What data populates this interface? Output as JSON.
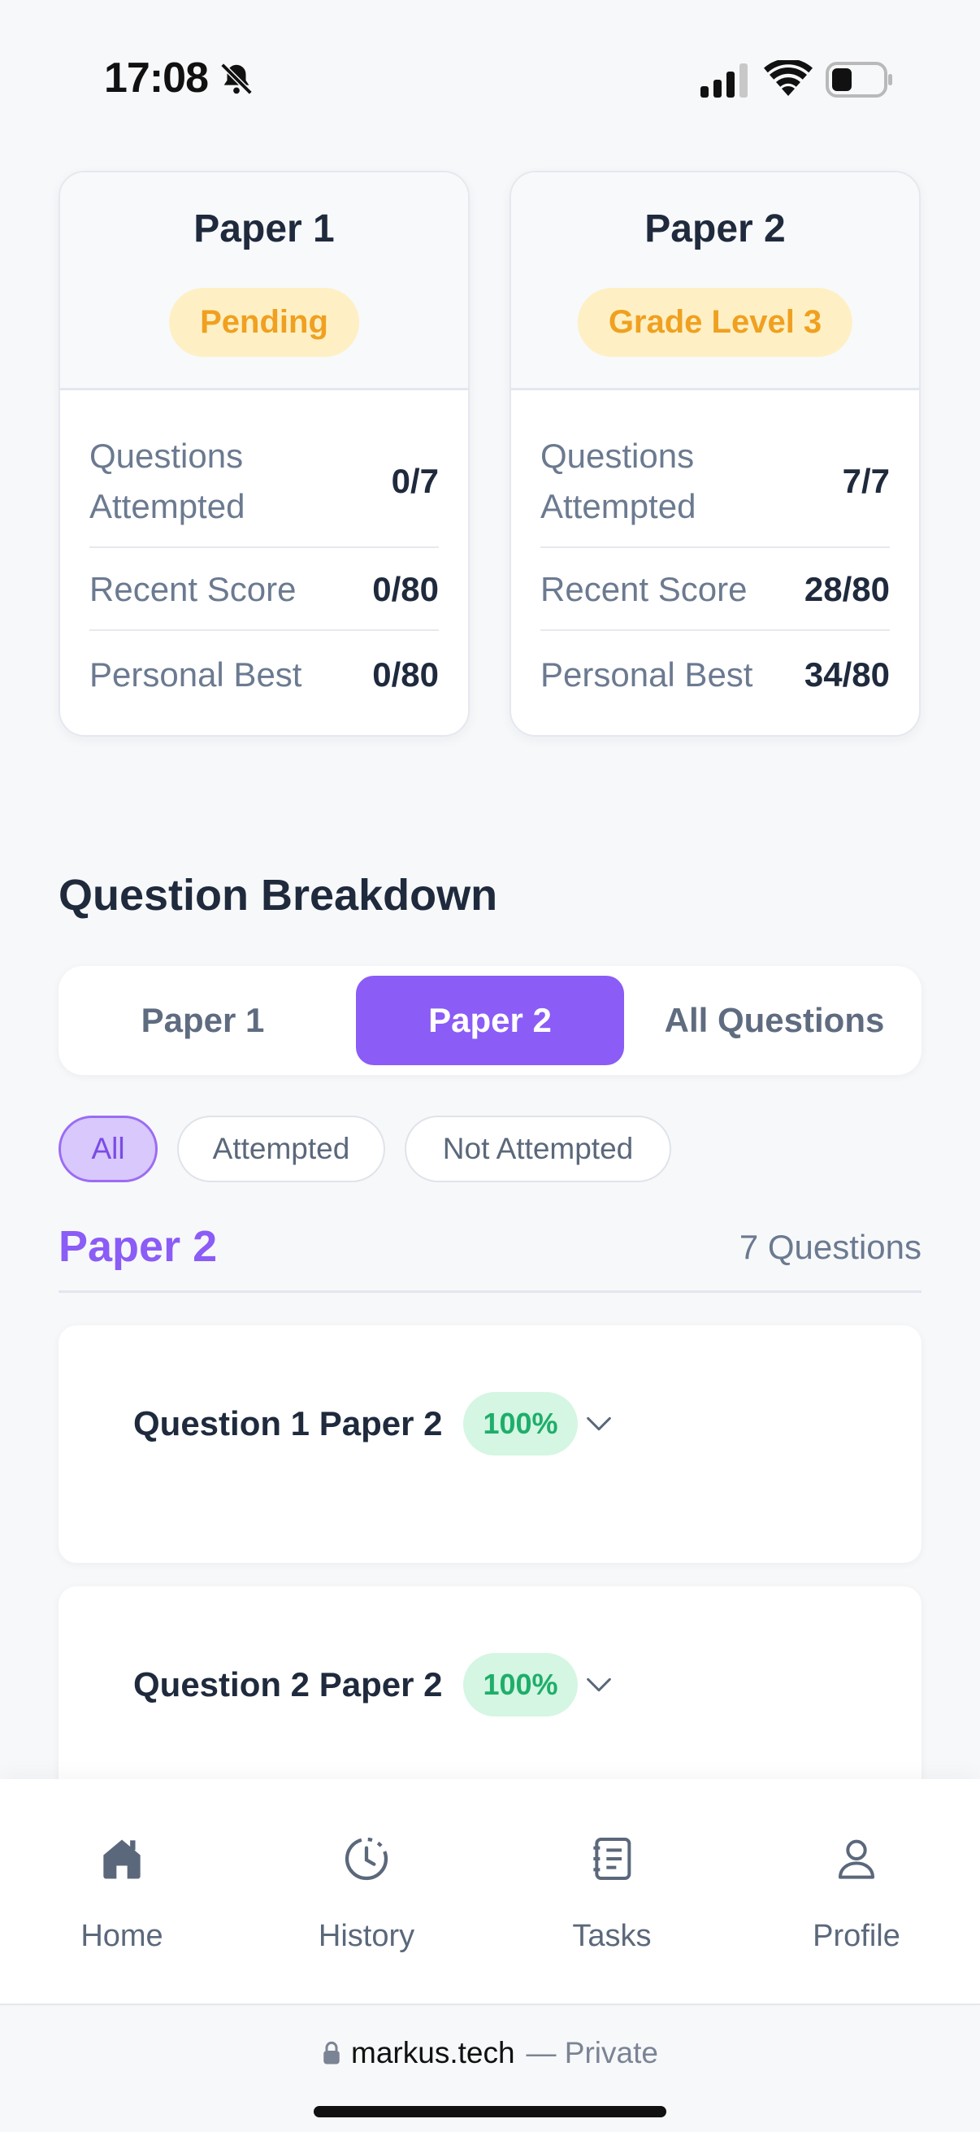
{
  "status_bar": {
    "time": "17:08"
  },
  "cards": [
    {
      "title": "Paper 1",
      "badge": "Pending",
      "stats": [
        {
          "label": "Questions Attempted",
          "value": "0/7"
        },
        {
          "label": "Recent Score",
          "value": "0/80"
        },
        {
          "label": "Personal Best",
          "value": "0/80"
        }
      ]
    },
    {
      "title": "Paper 2",
      "badge": "Grade Level 3",
      "stats": [
        {
          "label": "Questions Attempted",
          "value": "7/7"
        },
        {
          "label": "Recent Score",
          "value": "28/80"
        },
        {
          "label": "Personal Best",
          "value": "34/80"
        }
      ]
    }
  ],
  "breakdown": {
    "title": "Question Breakdown",
    "tabs": [
      "Paper 1",
      "Paper 2",
      "All Questions"
    ],
    "active_tab": "Paper 2",
    "filters": [
      "All",
      "Attempted",
      "Not Attempted"
    ],
    "active_filter": "All",
    "group": {
      "title": "Paper 2",
      "count": "7 Questions",
      "questions": [
        {
          "title": "Question 1 Paper 2",
          "score": "100%"
        },
        {
          "title": "Question 2 Paper 2",
          "score": "100%"
        }
      ]
    }
  },
  "nav": {
    "items": [
      {
        "label": "Home",
        "icon": "home-icon"
      },
      {
        "label": "History",
        "icon": "history-icon"
      },
      {
        "label": "Tasks",
        "icon": "tasks-icon"
      },
      {
        "label": "Profile",
        "icon": "profile-icon"
      }
    ]
  },
  "browser": {
    "host": "markus.tech",
    "privacy": "— Private"
  },
  "colors": {
    "accent": "#8b5cf6",
    "badge_bg": "#fef0c4",
    "badge_text": "#f0a020",
    "score_bg": "#d4f6e3",
    "score_text": "#1fae6a"
  }
}
